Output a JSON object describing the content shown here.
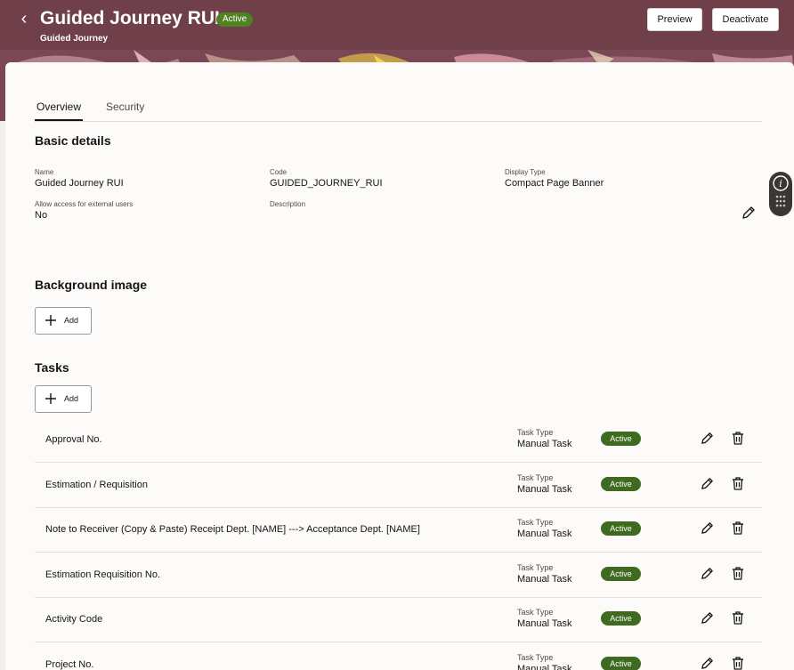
{
  "header": {
    "title": "Guided Journey RUI",
    "status": "Active",
    "subtitle": "Guided Journey",
    "preview_label": "Preview",
    "deactivate_label": "Deactivate"
  },
  "tabs": [
    {
      "label": "Overview",
      "active": true
    },
    {
      "label": "Security",
      "active": false
    }
  ],
  "basic_details": {
    "title": "Basic details",
    "fields": {
      "name": {
        "label": "Name",
        "value": "Guided Journey RUI"
      },
      "code": {
        "label": "Code",
        "value": "GUIDED_JOURNEY_RUI"
      },
      "display_type": {
        "label": "Display Type",
        "value": "Compact Page Banner"
      },
      "external": {
        "label": "Allow access for external users",
        "value": "No"
      },
      "description": {
        "label": "Description",
        "value": ""
      }
    }
  },
  "background_image": {
    "title": "Background image",
    "add_label": "Add"
  },
  "tasks": {
    "title": "Tasks",
    "add_label": "Add",
    "type_label": "Task Type",
    "items": [
      {
        "name": "Approval No.",
        "type": "Manual Task",
        "status": "Active"
      },
      {
        "name": "Estimation / Requisition",
        "type": "Manual Task",
        "status": "Active"
      },
      {
        "name": "Note to Receiver (Copy & Paste) Receipt Dept. [NAME] ---> Acceptance Dept. [NAME]",
        "type": "Manual Task",
        "status": "Active"
      },
      {
        "name": "Estimation Requisition No.",
        "type": "Manual Task",
        "status": "Active"
      },
      {
        "name": "Activity Code",
        "type": "Manual Task",
        "status": "Active"
      },
      {
        "name": "Project No.",
        "type": "Manual Task",
        "status": "Active"
      }
    ]
  },
  "colors": {
    "header_bg": "#6f3f4a",
    "active_badge": "#3e6b1f",
    "header_badge": "#508223"
  }
}
